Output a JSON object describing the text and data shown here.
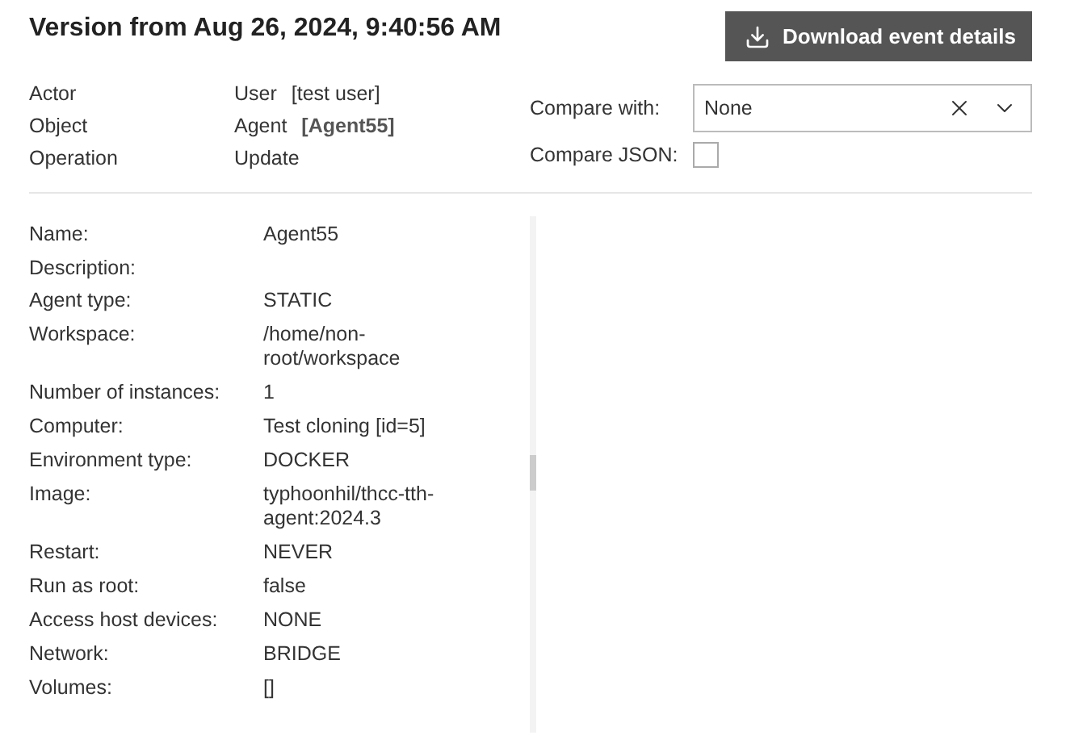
{
  "title": "Version from Aug 26, 2024, 9:40:56 AM",
  "download_button": "Download event details",
  "meta": [
    {
      "label": "Actor",
      "type": "User",
      "value": "[test user]",
      "bold": false
    },
    {
      "label": "Object",
      "type": "Agent",
      "value": "[Agent55]",
      "bold": true
    },
    {
      "label": "Operation",
      "type": "Update"
    }
  ],
  "compare_with": {
    "label": "Compare with:",
    "value": "None"
  },
  "compare_json": {
    "label": "Compare JSON:",
    "checked": false
  },
  "details": [
    {
      "label": "Name:",
      "value": "Agent55"
    },
    {
      "label": "Description:"
    },
    {
      "label": "Agent type:",
      "value": "STATIC"
    },
    {
      "label": "Workspace:",
      "value": "/home/non-root/workspace"
    },
    {
      "label": "Number of instances:",
      "value": "1"
    },
    {
      "label": "Computer:",
      "value": "Test cloning [id=5]"
    },
    {
      "label": "Environment type:",
      "value": "DOCKER"
    },
    {
      "label": "Image:",
      "value": "typhoonhil/thcc-tth-agent:2024.3"
    },
    {
      "label": "Restart:",
      "value": "NEVER"
    },
    {
      "label": "Run as root:",
      "value": "false"
    },
    {
      "label": "Access host devices:",
      "value": "NONE"
    },
    {
      "label": "Network:",
      "value": "BRIDGE"
    },
    {
      "label": "Volumes:",
      "value": "[]"
    }
  ]
}
